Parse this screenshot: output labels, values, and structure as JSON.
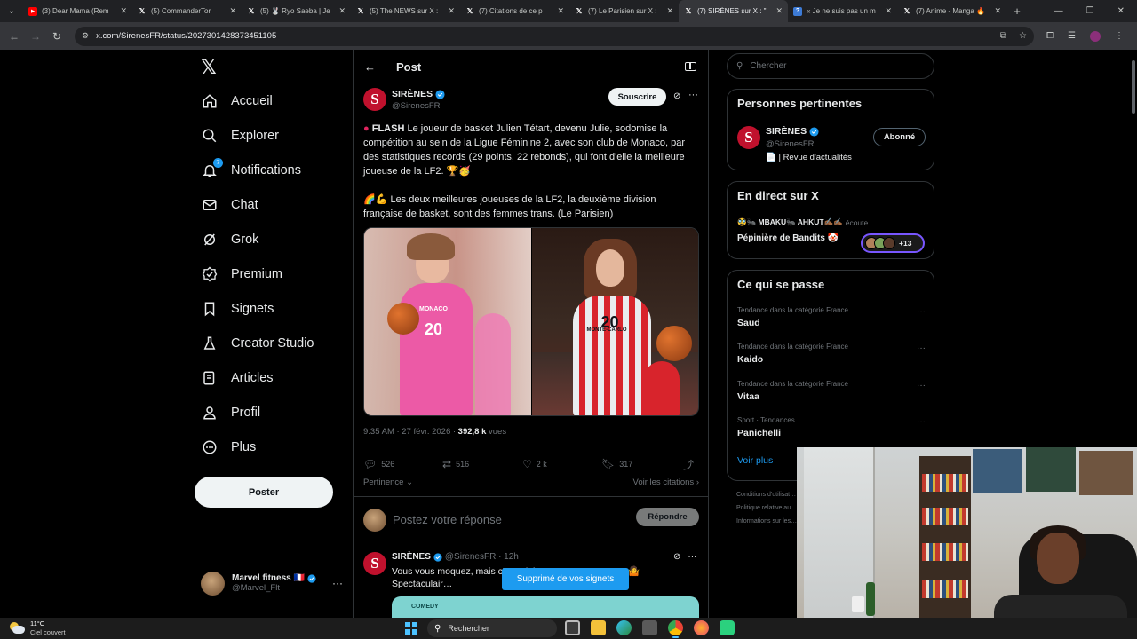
{
  "browser": {
    "tabs": [
      {
        "favicon": "youtube-icon",
        "title": "(3) Dear Mama (Rem",
        "active": false
      },
      {
        "favicon": "x-logo-icon",
        "title": "(5) CommanderTor",
        "active": false
      },
      {
        "favicon": "x-logo-icon",
        "title": "(5) 🐰 Ryo Saeba | Je",
        "active": false
      },
      {
        "favicon": "x-logo-icon",
        "title": "(5) The NEWS sur X :",
        "active": false
      },
      {
        "favicon": "x-logo-icon",
        "title": "(7) Citations de ce p",
        "active": false
      },
      {
        "favicon": "x-logo-icon",
        "title": "(7) Le Parisien sur X :",
        "active": false
      },
      {
        "favicon": "x-logo-icon",
        "title": "(7) SIRÈNES sur X : \"",
        "active": true
      },
      {
        "favicon": "wikipedia-icon",
        "title": "« Je ne suis pas un m",
        "active": false
      },
      {
        "favicon": "x-logo-icon",
        "title": "(7) Anime - Manga 🔥",
        "active": false
      }
    ],
    "url": "x.com/SirenesFR/status/2027301428373451105"
  },
  "nav": {
    "items": [
      {
        "label": "Accueil",
        "icon": "home-icon"
      },
      {
        "label": "Explorer",
        "icon": "search-icon"
      },
      {
        "label": "Notifications",
        "icon": "bell-icon",
        "badge": "7"
      },
      {
        "label": "Chat",
        "icon": "mail-icon"
      },
      {
        "label": "Grok",
        "icon": "grok-icon"
      },
      {
        "label": "Premium",
        "icon": "premium-icon"
      },
      {
        "label": "Signets",
        "icon": "bookmark-icon"
      },
      {
        "label": "Creator Studio",
        "icon": "creator-studio-icon"
      },
      {
        "label": "Articles",
        "icon": "articles-icon"
      },
      {
        "label": "Profil",
        "icon": "profile-icon"
      },
      {
        "label": "Plus",
        "icon": "more-circle-icon"
      }
    ],
    "post_button": "Poster",
    "account": {
      "name": "Marvel fitness 🇫🇷",
      "handle": "@Marvel_Flt"
    }
  },
  "main": {
    "header_title": "Post",
    "post": {
      "author": "SIRÈNES",
      "handle": "@SirenesFR",
      "subscribe_label": "Souscrire",
      "flash_label": "FLASH",
      "text1": "Le joueur de basket Julien Tétart, devenu Julie, sodomise la compétition au sein de la Ligue Féminine 2, avec son club de Monaco, par des statistiques records (29 points, 22 rebonds), qui font d'elle la meilleure joueuse de la LF2. 🏆🥳",
      "text2": "🌈💪 Les deux meilleures joueuses de la LF2, la deuxième division française de basket, sont des femmes trans.  (Le Parisien)",
      "jersey1_text": "MONACO",
      "jersey1_number": "20",
      "jersey2_text": "MONTE-CARLO",
      "jersey2_number": "20",
      "timestamp": "9:35 AM · 27 févr. 2026 · ",
      "views_count": "392,8 k",
      "views_label": " vues",
      "replies": "526",
      "reposts": "516",
      "likes": "2 k",
      "bookmarks": "317",
      "relevance_label": "Pertinence",
      "quotes_label": "Voir les citations"
    },
    "reply_placeholder": "Postez votre réponse",
    "reply_button": "Répondre",
    "post2": {
      "author": "SIRÈNES",
      "handle": "@SirenesFR · 12h",
      "text": "Vous vous moquez, mais c'… …inin n'est pas ennuyeux. 🤷 Spectaculair…",
      "card_label": "COMEDY"
    },
    "toast": "Supprimé de vos signets"
  },
  "right": {
    "search_placeholder": "Chercher",
    "relevant": {
      "title": "Personnes pertinentes",
      "name": "SIRÈNES",
      "handle": "@SirenesFR",
      "bio": "📄 | Revue d'actualités",
      "follow_label": "Abonné"
    },
    "live": {
      "title": "En direct sur X",
      "host": "🥸🐜 MBAKU🐜 AHKUT✍🏾✍🏾",
      "listen_label": "écoute.",
      "space_title": "Pépinière de Bandits 🤡",
      "extra_count": "+13"
    },
    "trends": {
      "title": "Ce qui se passe",
      "items": [
        {
          "category": "Tendance dans la catégorie France",
          "name": "Saud"
        },
        {
          "category": "Tendance dans la catégorie France",
          "name": "Kaido"
        },
        {
          "category": "Tendance dans la catégorie France",
          "name": "Vitaa"
        },
        {
          "category": "Sport · Tendances",
          "name": "Panichelli"
        }
      ],
      "more_label": "Voir plus"
    },
    "footer_links": [
      "Conditions d'utilisat…",
      "Politique relative au…",
      "Informations sur les…"
    ]
  },
  "taskbar": {
    "temperature": "11°C",
    "condition": "Ciel couvert",
    "search_placeholder": "Rechercher"
  },
  "colors": {
    "accent": "#1d9bf0",
    "brand_red": "#c0112d",
    "background": "#000000",
    "border": "#2f3336"
  }
}
